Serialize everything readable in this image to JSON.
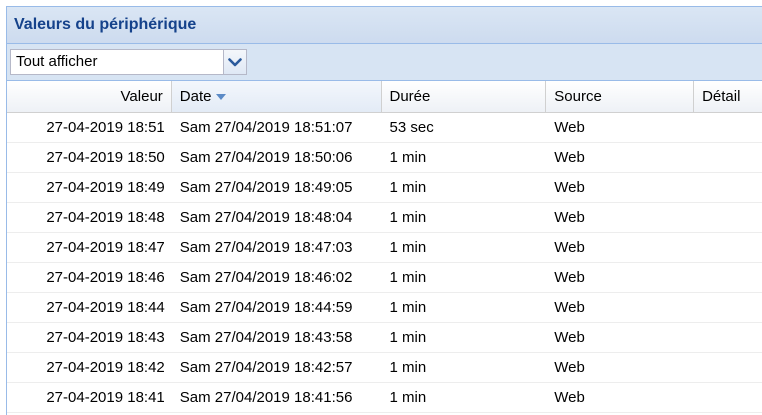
{
  "panel": {
    "title": "Valeurs du périphérique"
  },
  "filter": {
    "value": "Tout afficher",
    "trigger_icon": "chevron-down-icon"
  },
  "grid": {
    "columns": [
      {
        "label": "Valeur"
      },
      {
        "label": "Date",
        "sorted": "desc"
      },
      {
        "label": "Durée"
      },
      {
        "label": "Source"
      },
      {
        "label": "Détail"
      }
    ],
    "rows": [
      {
        "valeur": "27-04-2019 18:51",
        "date": "Sam 27/04/2019 18:51:07",
        "duree": "53 sec",
        "source": "Web",
        "detail": ""
      },
      {
        "valeur": "27-04-2019 18:50",
        "date": "Sam 27/04/2019 18:50:06",
        "duree": "1 min",
        "source": "Web",
        "detail": ""
      },
      {
        "valeur": "27-04-2019 18:49",
        "date": "Sam 27/04/2019 18:49:05",
        "duree": "1 min",
        "source": "Web",
        "detail": ""
      },
      {
        "valeur": "27-04-2019 18:48",
        "date": "Sam 27/04/2019 18:48:04",
        "duree": "1 min",
        "source": "Web",
        "detail": ""
      },
      {
        "valeur": "27-04-2019 18:47",
        "date": "Sam 27/04/2019 18:47:03",
        "duree": "1 min",
        "source": "Web",
        "detail": ""
      },
      {
        "valeur": "27-04-2019 18:46",
        "date": "Sam 27/04/2019 18:46:02",
        "duree": "1 min",
        "source": "Web",
        "detail": ""
      },
      {
        "valeur": "27-04-2019 18:44",
        "date": "Sam 27/04/2019 18:44:59",
        "duree": "1 min",
        "source": "Web",
        "detail": ""
      },
      {
        "valeur": "27-04-2019 18:43",
        "date": "Sam 27/04/2019 18:43:58",
        "duree": "1 min",
        "source": "Web",
        "detail": ""
      },
      {
        "valeur": "27-04-2019 18:42",
        "date": "Sam 27/04/2019 18:42:57",
        "duree": "1 min",
        "source": "Web",
        "detail": ""
      },
      {
        "valeur": "27-04-2019 18:41",
        "date": "Sam 27/04/2019 18:41:56",
        "duree": "1 min",
        "source": "Web",
        "detail": ""
      }
    ]
  },
  "colors": {
    "header_title": "#15428b",
    "panel_border": "#99bbe8",
    "sort_arrow": "#5b8ac6"
  }
}
